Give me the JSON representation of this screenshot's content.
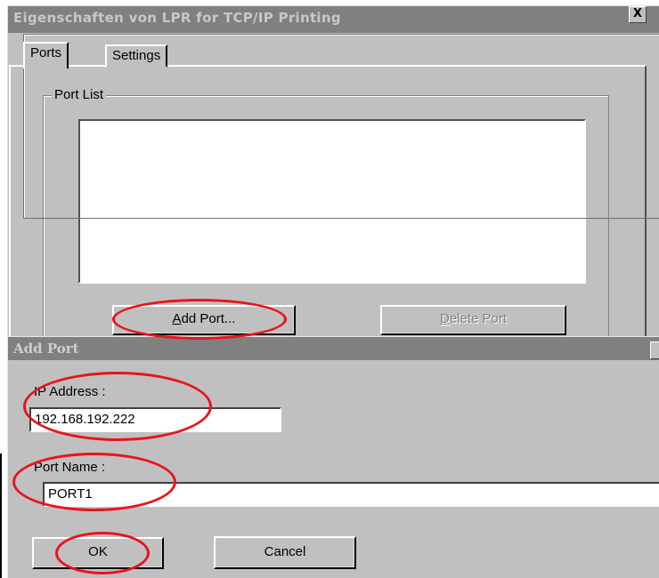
{
  "properties_window": {
    "title": "Eigenschaften von LPR for TCP/IP Printing",
    "close_glyph": "X",
    "tabs": [
      "Ports",
      "Settings"
    ],
    "group_label": "Port List",
    "add_port_label": "Add Port...",
    "add_port_mnemonic": "A",
    "delete_port_label": "Delete Port",
    "delete_port_mnemonic": "D"
  },
  "add_port_dialog": {
    "title": "Add Port",
    "ip_label": "IP Address :",
    "ip_value": "192.168.192.222",
    "port_name_label": "Port Name :",
    "port_name_value": "PORT1",
    "ok_label": "OK",
    "cancel_label": "Cancel"
  },
  "highlight_color": "#e8141b"
}
